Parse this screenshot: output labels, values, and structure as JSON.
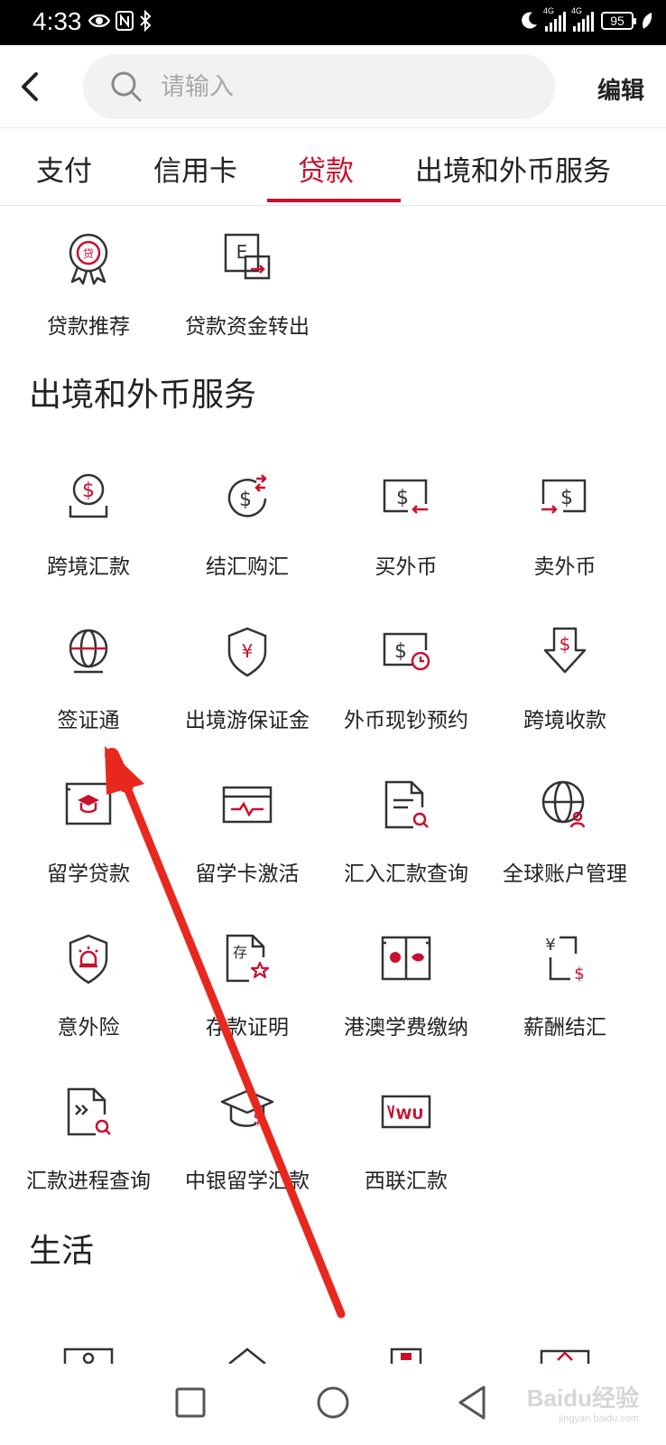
{
  "status_bar": {
    "time": "4:33",
    "battery": "95",
    "network_1": "4G",
    "network_2": "4G"
  },
  "header": {
    "search_placeholder": "请输入",
    "edit_label": "编辑"
  },
  "tabs": [
    {
      "label": "支付",
      "active": false
    },
    {
      "label": "信用卡",
      "active": false
    },
    {
      "label": "贷款",
      "active": true
    },
    {
      "label": "出境和外币服务",
      "active": false
    }
  ],
  "loan_section": {
    "items": [
      {
        "label": "贷款推荐",
        "icon": "loan-badge-icon"
      },
      {
        "label": "贷款资金转出",
        "icon": "fund-transfer-icon"
      }
    ]
  },
  "forex_section": {
    "title": "出境和外币服务",
    "items": [
      {
        "label": "跨境汇款",
        "icon": "cross-border-remit-icon"
      },
      {
        "label": "结汇购汇",
        "icon": "currency-exchange-icon"
      },
      {
        "label": "买外币",
        "icon": "buy-forex-icon"
      },
      {
        "label": "卖外币",
        "icon": "sell-forex-icon"
      },
      {
        "label": "签证通",
        "icon": "visa-globe-icon"
      },
      {
        "label": "出境游保证金",
        "icon": "shield-yen-icon"
      },
      {
        "label": "外币现钞预约",
        "icon": "cash-reserve-icon"
      },
      {
        "label": "跨境收款",
        "icon": "receive-dollar-icon"
      },
      {
        "label": "留学贷款",
        "icon": "study-loan-icon"
      },
      {
        "label": "留学卡激活",
        "icon": "card-activate-icon"
      },
      {
        "label": "汇入汇款查询",
        "icon": "document-search-icon"
      },
      {
        "label": "全球账户管理",
        "icon": "globe-user-icon"
      },
      {
        "label": "意外险",
        "icon": "shield-alarm-icon"
      },
      {
        "label": "存款证明",
        "icon": "deposit-cert-icon"
      },
      {
        "label": "港澳学费缴纳",
        "icon": "hk-macao-tuition-icon"
      },
      {
        "label": "薪酬结汇",
        "icon": "salary-exchange-icon"
      },
      {
        "label": "汇款进程查询",
        "icon": "remit-progress-icon"
      },
      {
        "label": "中银留学汇款",
        "icon": "grad-cap-dollar-icon"
      },
      {
        "label": "西联汇款",
        "icon": "western-union-icon"
      }
    ]
  },
  "life_section": {
    "title": "生活"
  },
  "watermark": {
    "text": "Baidu经验",
    "sub": "jingyan.baidu.com"
  },
  "colors": {
    "accent": "#c8102e",
    "icon_stroke": "#333333"
  }
}
